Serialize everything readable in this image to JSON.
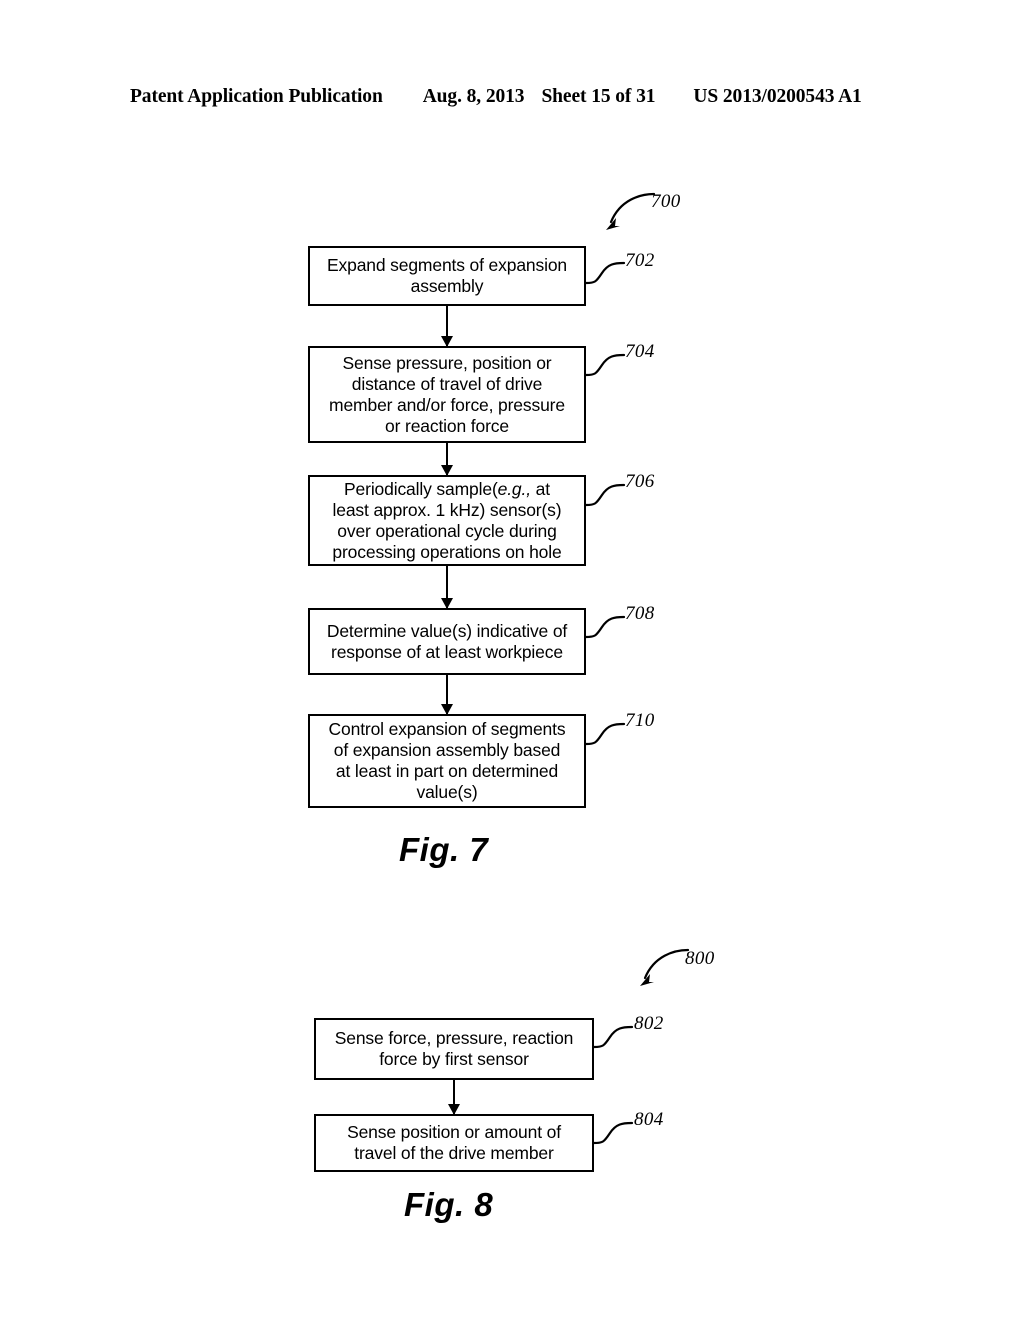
{
  "header": {
    "publication": "Patent Application Publication",
    "date": "Aug. 8, 2013",
    "sheet": "Sheet 15 of 31",
    "patent_number": "US 2013/0200543 A1"
  },
  "figures": [
    {
      "caption": "Fig. 7",
      "figure_ref": "700",
      "steps": [
        {
          "ref": "702",
          "lines": [
            "Expand segments of expansion",
            "assembly"
          ],
          "text": "Expand segments of expansion assembly"
        },
        {
          "ref": "704",
          "lines": [
            "Sense pressure, position or",
            "distance of travel of drive",
            "member and/or force, pressure",
            "or reaction force"
          ],
          "text": "Sense pressure, position or distance of travel of drive member and/or force, pressure or reaction force"
        },
        {
          "ref": "706",
          "lines": [
            "Periodically sample(e.g., at",
            "least approx. 1 kHz) sensor(s)",
            "over operational cycle during",
            "processing operations on hole"
          ],
          "text": "Periodically sample(e.g., at least approx. 1 kHz) sensor(s) over operational cycle during processing operations on hole",
          "italic_part": "e.g.,",
          "pre_italic": "Periodically sample(",
          "post_italic": " at least approx. 1 kHz) sensor(s) over operational cycle during processing operations on hole"
        },
        {
          "ref": "708",
          "lines": [
            "Determine value(s) indicative of",
            "response of at least workpiece"
          ],
          "text": "Determine value(s) indicative of response of at least workpiece"
        },
        {
          "ref": "710",
          "lines": [
            "Control expansion of segments",
            "of expansion assembly based",
            "at least in part on determined",
            "value(s)"
          ],
          "text": "Control expansion of segments of expansion assembly based at least in part on determined value(s)"
        }
      ]
    },
    {
      "caption": "Fig. 8",
      "figure_ref": "800",
      "steps": [
        {
          "ref": "802",
          "lines": [
            "Sense force, pressure, reaction",
            "force by first sensor"
          ],
          "text": "Sense force, pressure, reaction force by first sensor"
        },
        {
          "ref": "804",
          "lines": [
            "Sense position or amount of",
            "travel of the drive member"
          ],
          "text": "Sense position or amount of travel of the drive member"
        }
      ]
    }
  ],
  "colors": {
    "ink": "#000000",
    "paper": "#ffffff"
  }
}
